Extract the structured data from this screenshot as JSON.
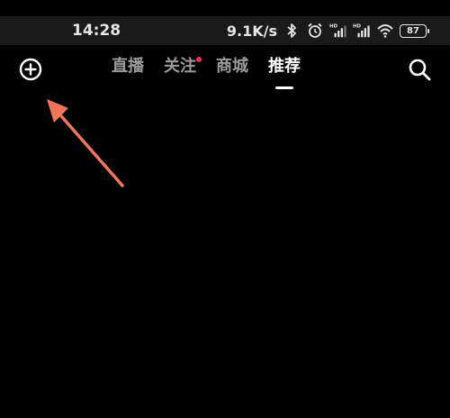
{
  "status_bar": {
    "time": "14:28",
    "net_speed": "9.1K/s",
    "battery": "87",
    "icons": [
      "bluetooth-icon",
      "alarm-icon",
      "signal-hd-icon",
      "signal-hd-icon",
      "wifi-icon",
      "battery-icon"
    ]
  },
  "nav": {
    "tabs": [
      {
        "label": "直播",
        "active": false,
        "badge": false
      },
      {
        "label": "关注",
        "active": false,
        "badge": true
      },
      {
        "label": "商城",
        "active": false,
        "badge": false
      },
      {
        "label": "推荐",
        "active": true,
        "badge": false
      }
    ],
    "left_icon": "plus-circle-icon",
    "right_icon": "search-icon"
  },
  "colors": {
    "background": "#000000",
    "status_bar": "#1a1a1a",
    "tab_inactive": "#9a9a9a",
    "tab_active": "#ffffff",
    "badge": "#ff2d55",
    "annotation_arrow": "#f0755a"
  }
}
